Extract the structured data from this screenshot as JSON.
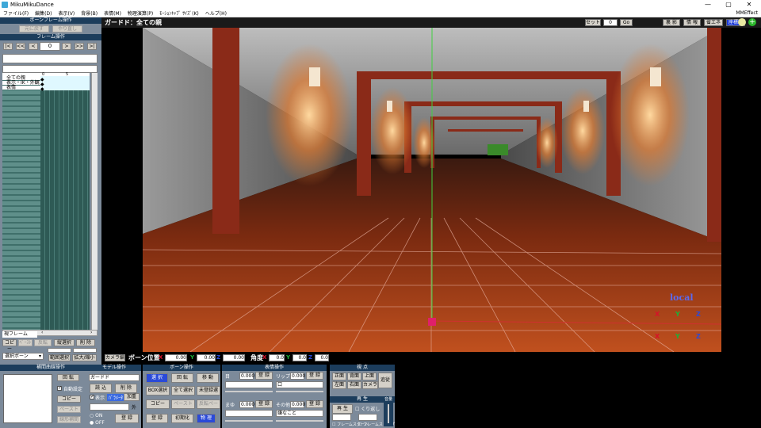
{
  "window": {
    "title": "MikuMikuDance",
    "minimize": "—",
    "maximize": "▢",
    "close": "✕"
  },
  "menu": [
    "ファイル(F)",
    "編集(D)",
    "表示(V)",
    "背景(B)",
    "表情(M)",
    "物理演算(P)",
    "ﾓｰｼｮﾝｷｬﾌﾟ ｻｲｽﾞ(K)",
    "ヘルプ(H)"
  ],
  "menu_right": "MMEffect",
  "left": {
    "bone_frame_header": "ボーンフレーム操作",
    "undo": "元に戻す",
    "redo": "やり直し",
    "frame_header": "フレーム操作",
    "frame_value": "0",
    "nav": [
      "|<",
      "<<",
      "<",
      ">",
      ">>",
      ">|"
    ],
    "timeline_rows": [
      "全ての親",
      "表示・IK・外観",
      "表情"
    ],
    "ruler": [
      "0",
      "5"
    ],
    "current_frame_label": "現フレーム",
    "copy": "コピー",
    "paste": "ﾍﾟｰｽﾄ",
    "reverse": "反転",
    "vertical_select": "縦選択",
    "delete": "削 除",
    "select_bone": "選択ボーン",
    "range_select": "範囲選択",
    "zoom": "拡大/縮小",
    "interp_header": "補間曲線操作",
    "rotate": "回 転",
    "auto_set": "自動設定",
    "copy2": "コピー",
    "paste2": "ペースト",
    "linear": "線形補間"
  },
  "viewport": {
    "title": "ガードド：全ての親",
    "set_label": "セット",
    "set_value": "0",
    "go": "Go",
    "buttons": [
      "裏 影",
      "情 報",
      "省エネ",
      "座標軸"
    ],
    "local_label": "local",
    "rot_axes": [
      "X",
      "Y",
      "Z"
    ],
    "move_axes": [
      "X",
      "Y",
      "Z"
    ]
  },
  "bonebar": {
    "camera_tab": "カメラ編",
    "bone_pos_label": "ボーン位置",
    "pos": {
      "x": "0.00",
      "y": "0.00",
      "z": "0.00"
    },
    "angle_label": "角度",
    "angle": {
      "x": "0.0",
      "y": "0.0",
      "z": "0.0"
    }
  },
  "model_panel": {
    "header": "モデル操作",
    "model_name": "ガードド",
    "load": "読 込",
    "delete": "削 除",
    "display": "表示",
    "half": "ﾊﾟﾗﾒｰﾀ",
    "add": "加重",
    "outside": "外",
    "on": "ON",
    "off": "OFF",
    "register": "登 録"
  },
  "bone_panel": {
    "header": "ボーン操作",
    "select": "選 択",
    "rotate": "回 転",
    "move": "移 動",
    "box_select": "BOX選択",
    "select_all": "全て選択",
    "unregistered": "未登録選",
    "copy": "コピー",
    "paste": "ペースト",
    "reverse_paste": "反転ペースト",
    "register": "登 録",
    "init": "初期化",
    "physics": "物 理"
  },
  "face_panel": {
    "header": "表情操作",
    "eye_label": "目",
    "eye_value": "0.000",
    "lip_label": "リップ",
    "lip_value": "0.000",
    "eye_select": "",
    "lip_select": "口",
    "brow_label": "まゆ",
    "brow_value": "0.000",
    "other_label": "その他",
    "other_value": "0.000",
    "brow_select": "",
    "other_select": "嫌なこと",
    "register": "登 録"
  },
  "view_panel": {
    "header": "視 点",
    "front": "正面",
    "back": "背面",
    "top": "上面",
    "track": "追従",
    "left": "左面",
    "right": "右面",
    "camera": "カメラ",
    "play_header": "再 生",
    "play": "再 生",
    "repeat": "くり返し",
    "frame_start": "フレームスタート",
    "frame_stop": "フレームストップ",
    "volume_label": "音量"
  },
  "colors": {
    "panel": "#7c8a9a",
    "header": "#1c3d5c",
    "accent_red": "#d8102a",
    "accent_green": "#1ab238",
    "accent_blue": "#2a4ad8"
  }
}
